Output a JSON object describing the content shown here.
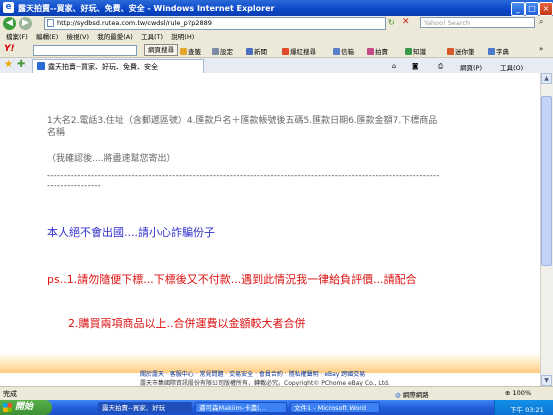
{
  "window": {
    "title": "露天拍賣--買家、好玩、免費、安全 - Windows Internet Explorer",
    "minimize": "_",
    "maximize": "□",
    "close": "×"
  },
  "address": {
    "url": "http://sydbsd.rutea.com.tw/cwdsl/rule_p?p2889",
    "search_placeholder": "Yahoo! Search"
  },
  "menu": [
    "檔案(F)",
    "編輯(E)",
    "檢視(V)",
    "我的最愛(A)",
    "工具(T)",
    "說明(H)"
  ],
  "yahoo_toolbar": {
    "logo": "Y!",
    "web_search": "網頁搜尋",
    "items": [
      "查籤",
      "設定",
      "新聞",
      "爆紅搜尋",
      "信箱",
      "拍賣",
      "知識",
      "迷你筆",
      "字典"
    ]
  },
  "tab": {
    "label": "露天拍賣--買家、好玩、免費、安全"
  },
  "right_tools": {
    "page": "網頁(P)",
    "tools": "工具(O)"
  },
  "content": {
    "instructions": "1大名2.電話3.住址（含郵遞區號）4.匯款戶名＋匯款帳號後五碼5.匯款日期6.匯款金額7.下標商品名稱",
    "note": "（我確認後....將盡速幫您寄出）",
    "dashes": "------------------------------------------------------------------------------------------------------------------------------------",
    "warning": "本人絕不會出國....請小心詐騙份子",
    "ps1": "ps..1.請勿隨便下標...下標後又不付款...遇到此情況我一律給負評價...請配合",
    "ps2": "2.購買兩項商品以上..合併運費以金額較大者合併"
  },
  "footer": {
    "links": "關於露天 ‧ 客服中心 ‧ 常見問題 ‧ 交易安全 ‧ 會員合約 ‧ 隱私權聲明 ‧ eBay 跨國交易",
    "copyright": "露天市集國際資訊股份有限公司版權所有，轉載必究。Copyright© PChome eBay Co., Ltd."
  },
  "status": {
    "text": "完成",
    "zone": "網際網路",
    "zoom": "100%"
  },
  "taskbar": {
    "start": "開始",
    "tasks": [
      "露天拍賣--買家、好玩",
      "邁可森Makiim-卡農(...",
      "文件1 - Microsoft Word"
    ],
    "clock": "下午 03:21"
  }
}
